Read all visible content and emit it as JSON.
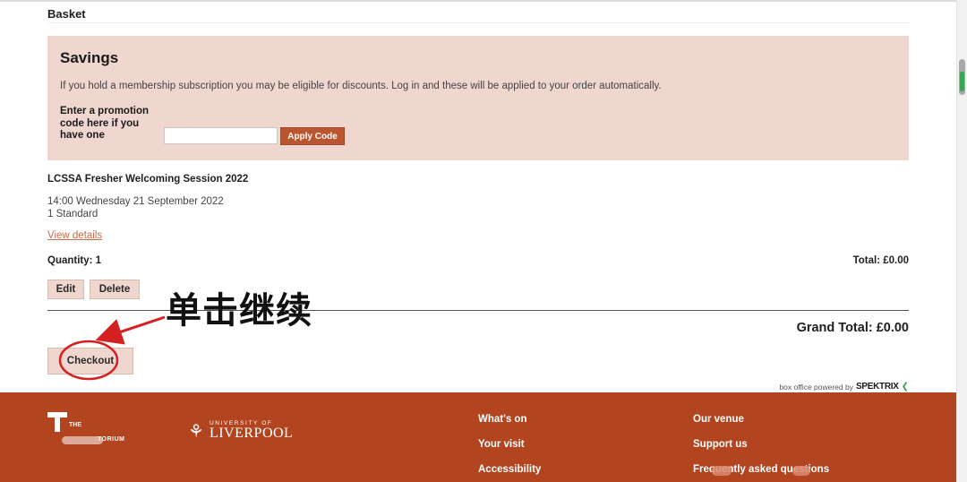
{
  "basket": {
    "title": "Basket"
  },
  "savings": {
    "title": "Savings",
    "description": "If you hold a membership subscription you may be eligible for discounts. Log in and these will be applied to your order automatically.",
    "promo_label": "Enter a promotion code here if you have one",
    "promo_input_value": "",
    "apply_label": "Apply Code"
  },
  "item": {
    "title": "LCSSA Fresher Welcoming Session 2022",
    "datetime": "14:00 Wednesday 21 September 2022",
    "ticket": "1 Standard",
    "view_details": "View details",
    "quantity": "Quantity: 1",
    "total": "Total: £0.00",
    "edit_label": "Edit",
    "delete_label": "Delete"
  },
  "grand_total": "Grand Total: £0.00",
  "checkout_label": "Checkout",
  "annotation": {
    "text": "单击继续",
    "color": "#d42020"
  },
  "powered_by": {
    "prefix": "box office powered by",
    "brand": "SPEKTRIX"
  },
  "footer": {
    "background": "#b2451f",
    "theatre_logo_top": "THE",
    "theatre_logo_bottom": "TORIUM",
    "university_small": "UNIVERSITY OF",
    "university_big": "LIVERPOOL",
    "links_col1": [
      "What's on",
      "Your visit",
      "Accessibility"
    ],
    "links_col2": [
      "Our venue",
      "Support us",
      "Frequently asked questions"
    ]
  },
  "colors": {
    "accent": "#b9552f",
    "panel": "#efd6cf",
    "link": "#c96a4a"
  }
}
